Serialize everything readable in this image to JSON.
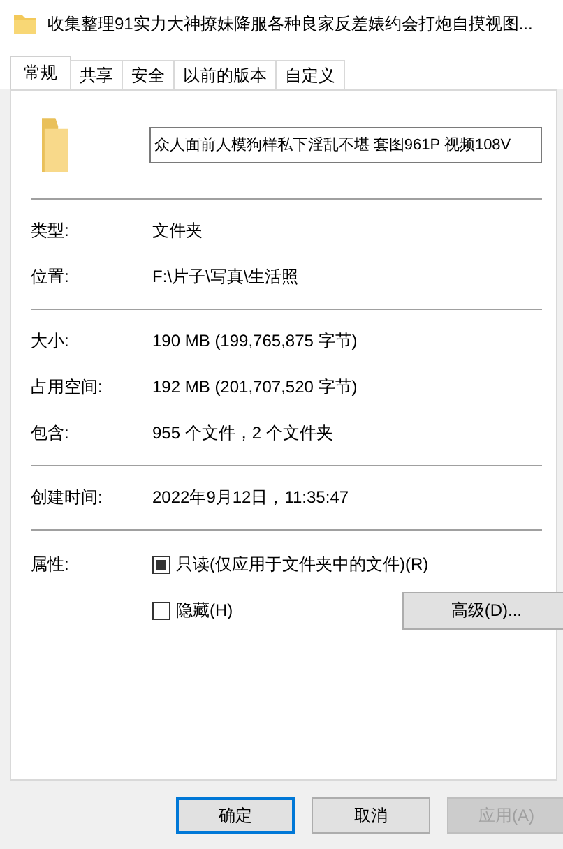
{
  "window": {
    "title": "收集整理91实力大神撩妹降服各种良家反差婊约会打炮自摸视图..."
  },
  "tabs": [
    {
      "label": "常规",
      "selected": true
    },
    {
      "label": "共享",
      "selected": false
    },
    {
      "label": "安全",
      "selected": false
    },
    {
      "label": "以前的版本",
      "selected": false
    },
    {
      "label": "自定义",
      "selected": false
    }
  ],
  "name_field": {
    "value": "众人面前人模狗样私下淫乱不堪 套图961P 视频108V"
  },
  "groups": [
    [
      {
        "label": "类型:",
        "value": "文件夹"
      },
      {
        "label": "位置:",
        "value": "F:\\片子\\写真\\生活照"
      }
    ],
    [
      {
        "label": "大小:",
        "value": "190 MB (199,765,875 字节)"
      },
      {
        "label": "占用空间:",
        "value": "192 MB (201,707,520 字节)"
      },
      {
        "label": "包含:",
        "value": "955 个文件，2 个文件夹"
      }
    ],
    [
      {
        "label": "创建时间:",
        "value": "2022年9月12日，11:35:47"
      }
    ]
  ],
  "attributes": {
    "label": "属性:",
    "checkboxes": [
      {
        "label": "只读(仅应用于文件夹中的文件)(R)",
        "checked": true,
        "partial": true
      },
      {
        "label": "隐藏(H)",
        "checked": false,
        "partial": false
      }
    ],
    "advanced_button": "高级(D)..."
  },
  "buttons": [
    {
      "label": "确定",
      "default": true,
      "disabled": false
    },
    {
      "label": "取消",
      "default": false,
      "disabled": false
    },
    {
      "label": "应用(A)",
      "default": false,
      "disabled": true
    }
  ]
}
